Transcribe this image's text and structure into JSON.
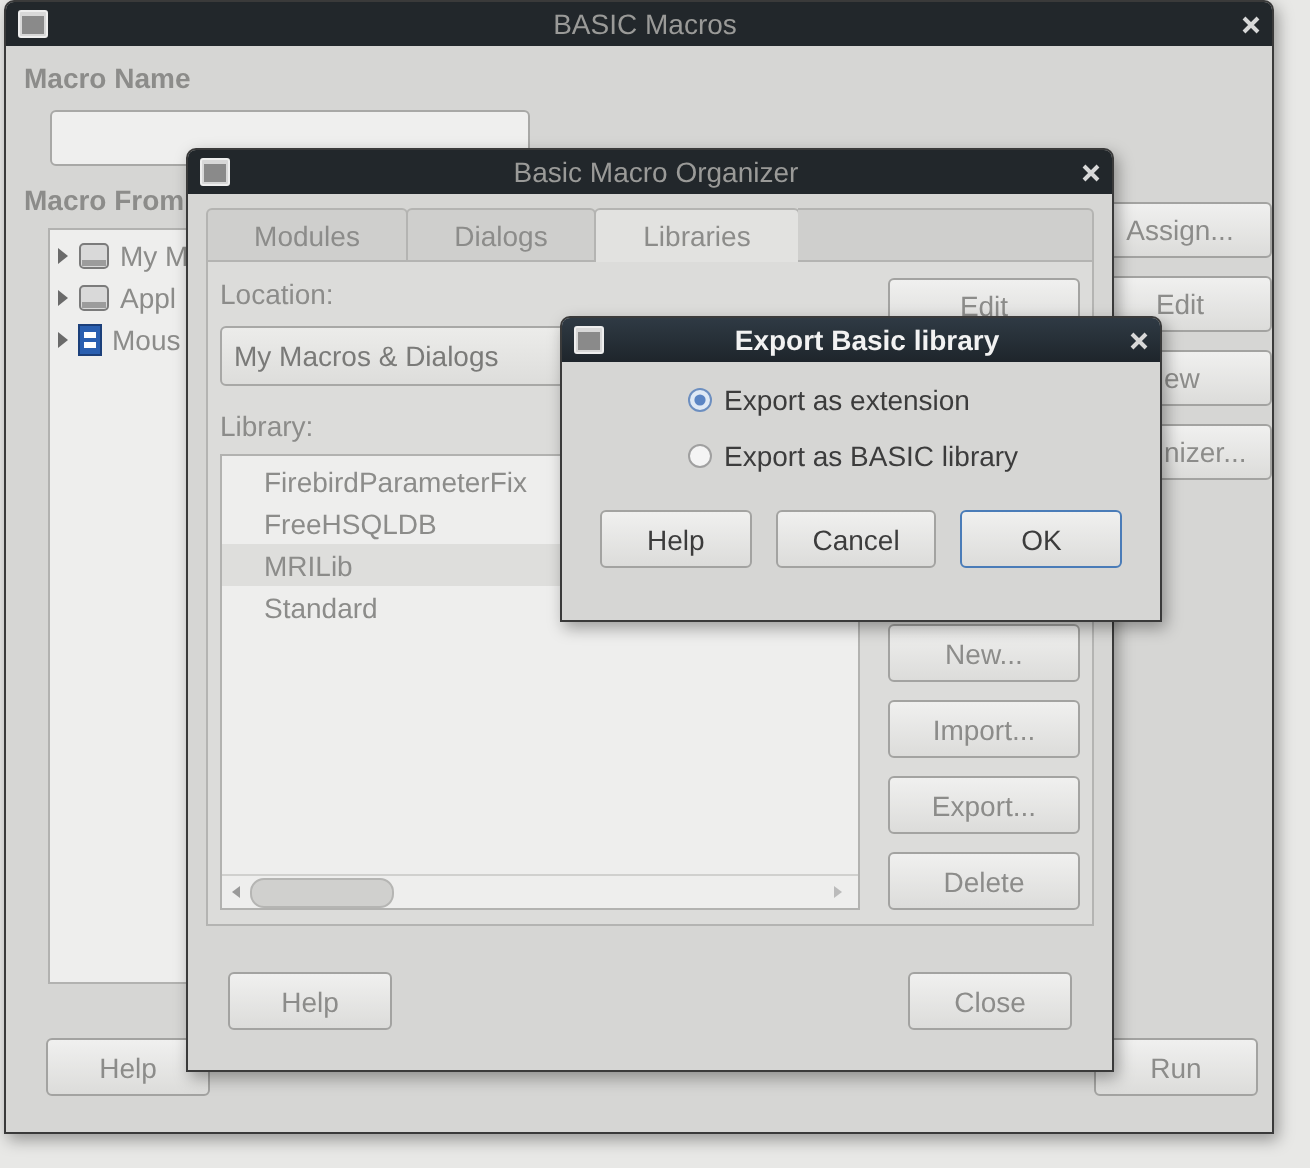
{
  "main_window": {
    "title": "BASIC Macros",
    "active": false,
    "macro_name_label": "Macro Name",
    "macro_from_label": "Macro From",
    "tree": [
      {
        "label": "My M",
        "kind": "drive",
        "expanded": false
      },
      {
        "label": "Appl",
        "kind": "drive",
        "expanded": false
      },
      {
        "label": "Mous",
        "kind": "document",
        "expanded": false
      }
    ],
    "side_buttons": [
      "Assign...",
      "Edit",
      "ew",
      "nizer..."
    ],
    "help_button": "Help",
    "run_button": "Run"
  },
  "organizer_window": {
    "title": "Basic Macro Organizer",
    "active": false,
    "tabs": [
      {
        "label": "Modules",
        "selected": false
      },
      {
        "label": "Dialogs",
        "selected": false
      },
      {
        "label": "Libraries",
        "selected": true
      }
    ],
    "location_label": "Location:",
    "location_value": "My Macros & Dialogs",
    "library_label": "Library:",
    "libraries": [
      {
        "label": "FirebirdParameterFix",
        "selected": false
      },
      {
        "label": "FreeHSQLDB",
        "selected": false
      },
      {
        "label": "MRILib",
        "selected": true
      },
      {
        "label": "Standard",
        "selected": false
      }
    ],
    "top_button": "Edit",
    "side_buttons": [
      "New...",
      "Import...",
      "Export...",
      "Delete"
    ],
    "help_button": "Help",
    "close_button": "Close"
  },
  "export_dialog": {
    "title": "Export Basic library",
    "active": true,
    "options": [
      {
        "label": "Export as extension",
        "selected": true
      },
      {
        "label": "Export as BASIC library",
        "selected": false
      }
    ],
    "buttons": [
      {
        "label": "Help",
        "default": false
      },
      {
        "label": "Cancel",
        "default": false
      },
      {
        "label": "OK",
        "default": true
      }
    ]
  }
}
